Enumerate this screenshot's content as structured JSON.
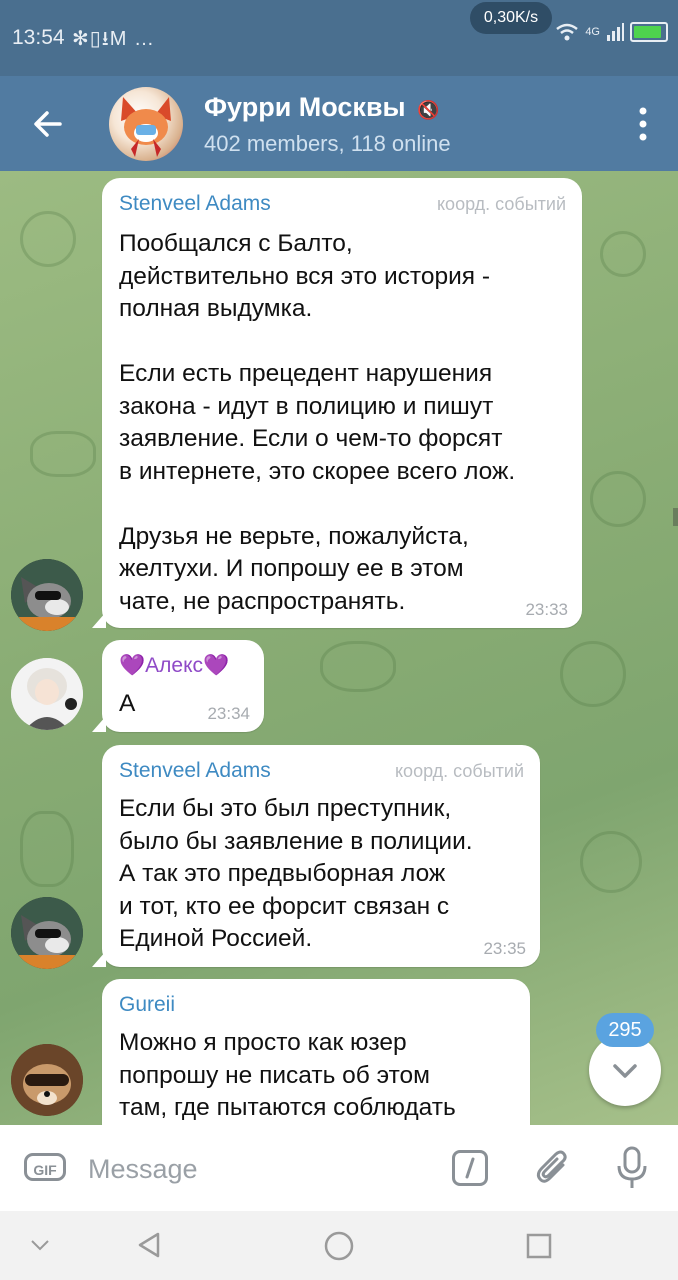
{
  "status_bar": {
    "time": "13:54",
    "left_icons": "✻▯⭳M …",
    "net_speed": "0,30K/s",
    "network": "4G",
    "battery_level": 0.9
  },
  "header": {
    "title": "Фурри Москвы",
    "subtitle": "402 members, 118 online",
    "icons": [
      "back-arrow-icon",
      "mute-icon",
      "more-vertical-icon"
    ]
  },
  "messages": [
    {
      "sender": "Stenveel Adams",
      "role": "коорд. событий",
      "text": "Пообщался с Балто,\nдействительно вся это история -\nполная выдумка.\n\nЕсли есть прецедент нарушения\nзакона - идут в полицию и пишут\nзаявление. Если о чем-то форсят\nв интернете, это скорее всего лож.\n\nДрузья не верьте, пожалуйста,\nжелтухи. И попрошу ее в этом\nчате, не распространять.",
      "time": "23:33"
    },
    {
      "sender": "💜Алекс💜",
      "role": "",
      "text": "А",
      "time": "23:34"
    },
    {
      "sender": "Stenveel Adams",
      "role": "коорд. событий",
      "text": "Если бы это был преступник,\nбыло бы заявление в полиции.\nА так это предвыборная лож\nи тот, кто ее форсит связан с\nЕдиной Россией.",
      "time": "23:35"
    },
    {
      "sender": "Gureii",
      "role": "",
      "text": "Можно я просто как юзер\nпопрошу не писать об этом\nтам, где пытаются соблюдать",
      "time": ""
    }
  ],
  "scroll_down": {
    "unread_count": "295"
  },
  "composer": {
    "placeholder": "Message",
    "gif_label": "GIF",
    "icons": [
      "gif-icon",
      "bot-command-icon",
      "attach-icon",
      "microphone-icon"
    ]
  },
  "nav_icons": [
    "collapse-icon",
    "back-triangle-icon",
    "home-circle-icon",
    "recents-square-icon"
  ],
  "colors": {
    "header": "#517ba1",
    "status_bar": "#4a6f8f",
    "sender_name": "#3e8ac2",
    "badge": "#5aa3e0",
    "chat_bg": "#8fb07a"
  }
}
